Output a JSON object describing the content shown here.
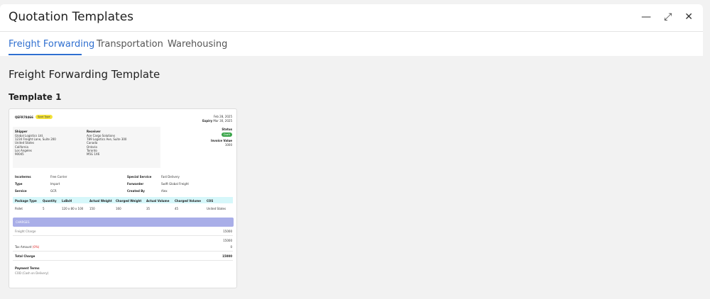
{
  "window": {
    "title": "Quotation Templates",
    "minimize": "—",
    "maximize": "⤢",
    "close": "✕"
  },
  "tabs": [
    {
      "label": "Freight Forwarding"
    },
    {
      "label": "Transportation"
    },
    {
      "label": "Warehousing"
    }
  ],
  "section_title": "Freight Forwarding Template",
  "template": {
    "name": "Template 1",
    "quote_id": "QEFR78466",
    "tag": "Spot Type",
    "date": "Feb 28, 2025",
    "expiry_label": "Expiry",
    "expiry": "Mar 30, 2025",
    "status_label": "Status",
    "status": "Draft",
    "invoice_label": "Invoice Value",
    "invoice_value": "1000",
    "shipper": {
      "label": "Shipper",
      "lines": [
        "Global Logistics Ltd.",
        "1234 Freight Lane, Suite 200",
        "United States",
        "California",
        "Los Angeles",
        "90045"
      ]
    },
    "receiver": {
      "label": "Receiver",
      "lines": [
        "Ace Cargo Solutions",
        "789 Logistics Ave, Suite 300",
        "Canada",
        "Ontario",
        "Toronto",
        "M5G 1X6"
      ]
    },
    "details": [
      {
        "label": "Incoterms",
        "value": "Free Carrier"
      },
      {
        "label": "Type",
        "value": "Import"
      },
      {
        "label": "Service",
        "value": "GCR"
      }
    ],
    "details_right": [
      {
        "label": "Special Service",
        "value": "Fast Delivery"
      },
      {
        "label": "Forwarder",
        "value": "Swift Global Freight"
      },
      {
        "label": "Created By",
        "value": "Alex"
      }
    ],
    "package_headers": [
      "Package Type",
      "Quantity",
      "LxBxH",
      "Actual Weight",
      "Charged Weight",
      "Actual Volume",
      "Charged Volume",
      "COS"
    ],
    "package_row": [
      "Pallet",
      "5",
      "120 x 80 x 100",
      "150",
      "160",
      "35",
      "45",
      "United States"
    ],
    "charges_title": "CHARGES",
    "freight_charge_label": "Freight Charge",
    "freight_charge": "15000",
    "subtotal": "15000",
    "tax_label": "Tax Amount",
    "tax_pct": "(0%)",
    "tax_amount": "0",
    "total_label": "Total Charge",
    "total": "15000",
    "payment_terms_label": "Payment Terms",
    "payment_terms": "COD (Cash on Delivery)"
  }
}
